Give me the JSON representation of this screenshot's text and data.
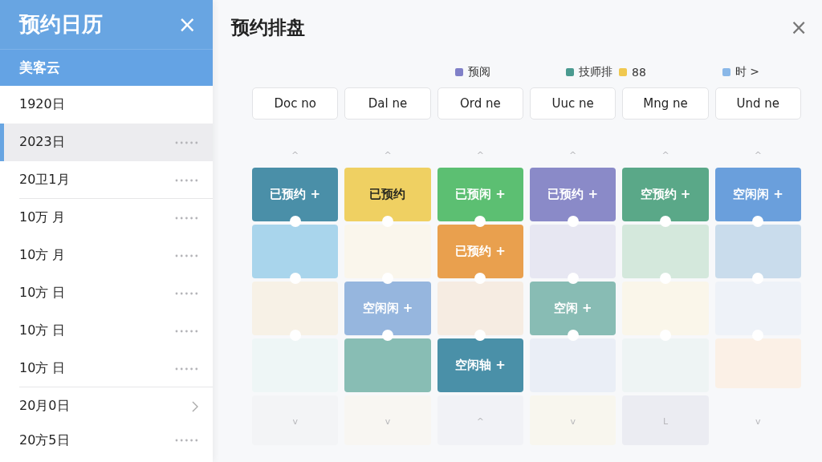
{
  "sidebar": {
    "title": "预约日历",
    "close": "×",
    "subtitle": "美客云",
    "items": [
      {
        "label": "1920日",
        "kind": "plain",
        "selected": false,
        "separator": false
      },
      {
        "label": "2023日",
        "kind": "dots",
        "selected": true,
        "separator": false
      },
      {
        "label": "20卫1月",
        "kind": "dots",
        "selected": false,
        "separator": true
      },
      {
        "label": "10万 月",
        "kind": "dots",
        "selected": false,
        "separator": false
      },
      {
        "label": "10方 月",
        "kind": "dots",
        "selected": false,
        "separator": false
      },
      {
        "label": "10方 日",
        "kind": "dots",
        "selected": false,
        "separator": false
      },
      {
        "label": "10方 日",
        "kind": "dots",
        "selected": false,
        "separator": false
      },
      {
        "label": "10方 日",
        "kind": "dots",
        "selected": false,
        "separator": true
      },
      {
        "label": "20月0日",
        "kind": "chevron",
        "selected": false,
        "separator": false
      },
      {
        "label": "20方5日",
        "kind": "dots",
        "selected": false,
        "separator": false
      }
    ]
  },
  "board": {
    "title": "预约排盘",
    "close": "×",
    "legend": [
      {
        "label": "预阅",
        "color": "#8080c8"
      },
      {
        "label": "技师排",
        "color": "#4a9a90"
      },
      {
        "label": "88",
        "color": "#f0c850"
      },
      {
        "label": "时 >",
        "color": "#8ab8e8"
      }
    ],
    "columns": [
      {
        "header": "Doc no",
        "top_mark": "^",
        "bottom_mark": "v",
        "cells": [
          {
            "label": "已预约 +",
            "color": "#4a8fa8"
          },
          {
            "color": "#a9d5ec"
          },
          {
            "color": "#f7f1e6"
          },
          {
            "color": "#eef6f6"
          },
          {
            "color": "#f3f4f6"
          }
        ]
      },
      {
        "header": "Dal ne",
        "top_mark": "^",
        "bottom_mark": "v",
        "cells": [
          {
            "label": "已预约",
            "color": "#efd062"
          },
          {
            "color": "#faf6ec"
          },
          {
            "label": "空闲闲 +",
            "color": "#96b6de"
          },
          {
            "color": "#88bdb4"
          },
          {
            "color": "#f8f6f2"
          }
        ]
      },
      {
        "header": "Ord ne",
        "top_mark": "^",
        "bottom_mark": "^",
        "cells": [
          {
            "label": "已预闲 +",
            "color": "#5cbf72"
          },
          {
            "label": "已预约 +",
            "color": "#e9a04e"
          },
          {
            "color": "#f6ece2"
          },
          {
            "label": "空闲轴 +",
            "color": "#4a90a8"
          },
          {
            "color": "#f1f2f6"
          }
        ]
      },
      {
        "header": "Uuc ne",
        "top_mark": "^",
        "bottom_mark": "v",
        "cells": [
          {
            "label": "已预约 +",
            "color": "#8a8ac8"
          },
          {
            "color": "#e7e7f2"
          },
          {
            "label": "空闲 +",
            "color": "#88bcb4"
          },
          {
            "color": "#eaeef6"
          },
          {
            "color": "#f8f6ee"
          }
        ]
      },
      {
        "header": "Mng ne",
        "top_mark": "^",
        "bottom_mark": "L",
        "cells": [
          {
            "label": "空预约 +",
            "color": "#5aa888"
          },
          {
            "color": "#d4e8dc"
          },
          {
            "color": "#faf6ea"
          },
          {
            "color": "#eef4f4"
          },
          {
            "color": "#ebecf2"
          }
        ]
      },
      {
        "header": "Und ne",
        "top_mark": "^",
        "bottom_mark": "v",
        "cells": [
          {
            "label": "空闲闲 +",
            "color": "#6a9fdc"
          },
          {
            "color": "#c9dcec"
          },
          {
            "color": "#eef2f8"
          },
          {
            "color": "#fbf0e6"
          }
        ]
      }
    ]
  }
}
